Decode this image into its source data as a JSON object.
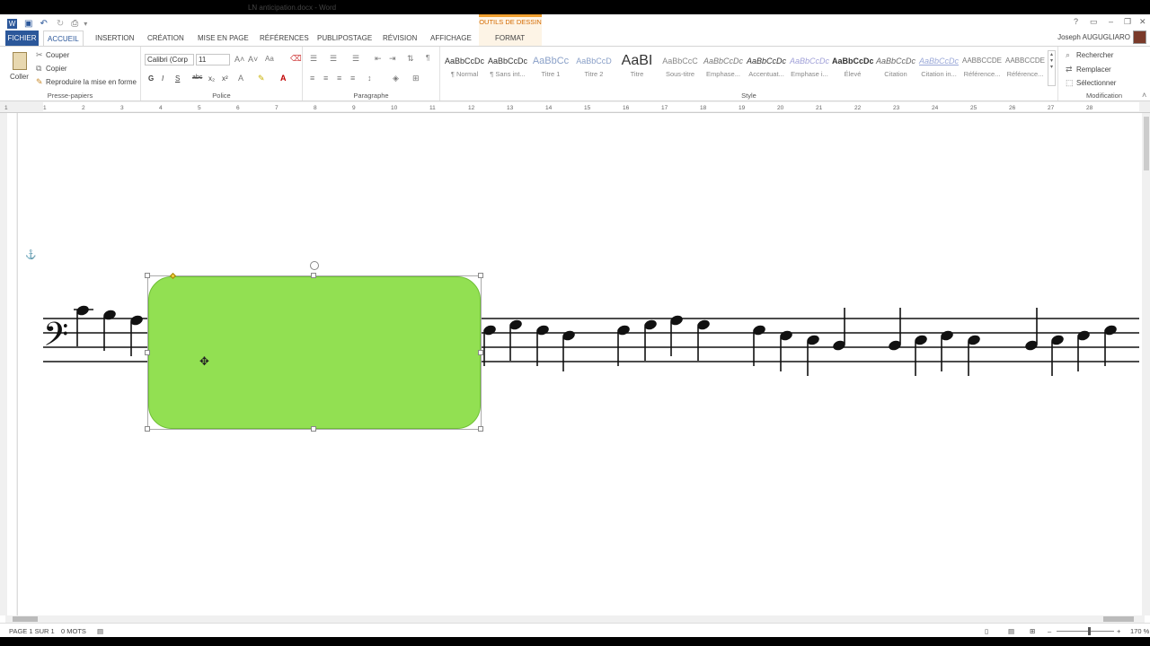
{
  "window": {
    "title": "LN anticipation.docx - Word",
    "contextual_group": "OUTILS DE DESSIN",
    "help": "?",
    "user": "Joseph AUGUGLIARO"
  },
  "tabs": [
    "FICHIER",
    "ACCUEIL",
    "INSERTION",
    "CRÉATION",
    "MISE EN PAGE",
    "RÉFÉRENCES",
    "PUBLIPOSTAGE",
    "RÉVISION",
    "AFFICHAGE",
    "FORMAT"
  ],
  "clipboard": {
    "paste": "Coller",
    "cut": "Couper",
    "copy": "Copier",
    "format_painter": "Reproduire la mise en forme",
    "label": "Presse-papiers"
  },
  "font": {
    "family": "Calibri (Corp",
    "size": "11",
    "change_case": "Aa",
    "bold": "G",
    "italic": "I",
    "underline": "S",
    "strikethrough": "abc",
    "subscript": "x₂",
    "superscript": "x²",
    "label": "Police"
  },
  "paragraph": {
    "label": "Paragraphe",
    "pilcrow": "¶"
  },
  "styles": {
    "label": "Style",
    "items": [
      {
        "preview": "AaBbCcDc",
        "name": "¶ Normal"
      },
      {
        "preview": "AaBbCcDc",
        "name": "¶ Sans int..."
      },
      {
        "preview": "AaBbCc",
        "name": "Titre 1"
      },
      {
        "preview": "AaBbCcD",
        "name": "Titre 2"
      },
      {
        "preview": "AaBI",
        "name": "Titre"
      },
      {
        "preview": "AaBbCcC",
        "name": "Sous-titre"
      },
      {
        "preview": "AaBbCcDc",
        "name": "Emphase..."
      },
      {
        "preview": "AaBbCcDc",
        "name": "Accentuat..."
      },
      {
        "preview": "AaBbCcDc",
        "name": "Emphase i..."
      },
      {
        "preview": "AaBbCcDc",
        "name": "Élevé"
      },
      {
        "preview": "AaBbCcDc",
        "name": "Citation"
      },
      {
        "preview": "AaBbCcDc",
        "name": "Citation in..."
      },
      {
        "preview": "AABBCCDE",
        "name": "Référence..."
      },
      {
        "preview": "AABBCCDE",
        "name": "Référence..."
      }
    ]
  },
  "editing": {
    "find": "Rechercher",
    "replace": "Remplacer",
    "select": "Sélectionner",
    "label": "Modification"
  },
  "ruler_numbers": [
    "1",
    "1",
    "2",
    "3",
    "4",
    "5",
    "6",
    "7",
    "8",
    "9",
    "10",
    "11",
    "12",
    "13",
    "14",
    "15",
    "16",
    "17",
    "18",
    "19",
    "20",
    "21",
    "22",
    "23",
    "24",
    "25",
    "26",
    "27",
    "28"
  ],
  "status": {
    "page": "PAGE 1 SUR 1",
    "words": "0 MOTS",
    "zoom": "170 %"
  },
  "colors": {
    "shape_fill": "#92e052",
    "accent": "#2b579a",
    "contextual": "#f0a030"
  }
}
